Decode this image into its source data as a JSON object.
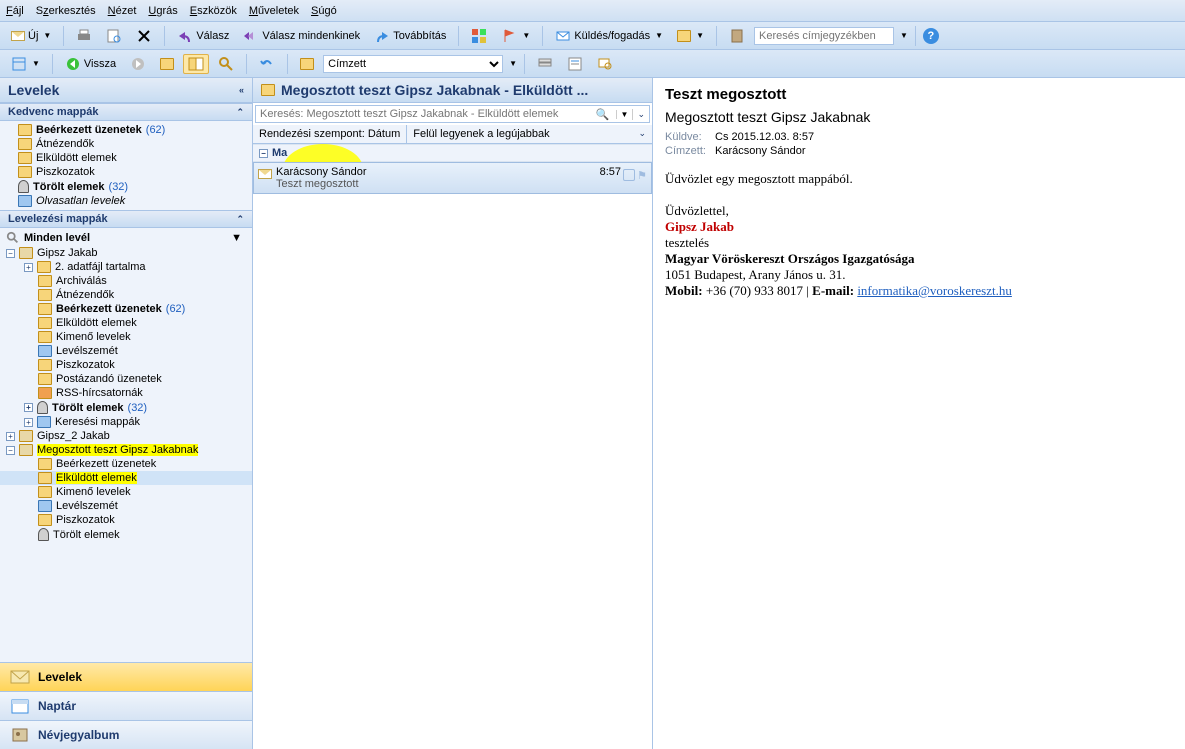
{
  "menu": {
    "file": "Fájl",
    "edit": "Szerkesztés",
    "view": "Nézet",
    "go": "Ugrás",
    "tools": "Eszközök",
    "actions": "Műveletek",
    "help": "Súgó"
  },
  "tb1": {
    "new": "Új",
    "reply": "Válasz",
    "replyall": "Válasz mindenkinek",
    "forward": "Továbbítás",
    "sendreceive": "Küldés/fogadás",
    "search_placeholder": "Keresés címjegyzékben"
  },
  "tb2": {
    "back": "Vissza",
    "field": "Címzett"
  },
  "left": {
    "header": "Levelek",
    "fav_header": "Kedvenc mappák",
    "fav": [
      {
        "label": "Beérkezett üzenetek",
        "count": "(62)",
        "bold": true,
        "ico": "yellow"
      },
      {
        "label": "Átnézendők",
        "ico": "yellow"
      },
      {
        "label": "Elküldött elemek",
        "ico": "yellow"
      },
      {
        "label": "Piszkozatok",
        "ico": "yellow"
      },
      {
        "label": "Törölt elemek",
        "count": "(32)",
        "bold": true,
        "ico": "trash"
      },
      {
        "label": "Olvasatlan levelek",
        "italic": true,
        "ico": "blue"
      }
    ],
    "mail_header": "Levelezési mappák",
    "all_label": "Minden levél",
    "tree_root": "Gipsz Jakab",
    "tree": [
      {
        "label": "2. adatfájl tartalma",
        "ind": 2,
        "ico": "yellow",
        "exp": "+"
      },
      {
        "label": "Archiválás",
        "ind": 2,
        "ico": "yellow"
      },
      {
        "label": "Átnézendők",
        "ind": 2,
        "ico": "yellow"
      },
      {
        "label": "Beérkezett üzenetek",
        "count": "(62)",
        "ind": 2,
        "bold": true,
        "ico": "yellow"
      },
      {
        "label": "Elküldött elemek",
        "ind": 2,
        "ico": "yellow"
      },
      {
        "label": "Kimenő levelek",
        "ind": 2,
        "ico": "yellow"
      },
      {
        "label": "Levélszemét",
        "ind": 2,
        "ico": "blue"
      },
      {
        "label": "Piszkozatok",
        "ind": 2,
        "ico": "yellow"
      },
      {
        "label": "Postázandó üzenetek",
        "ind": 2,
        "ico": "yellow"
      },
      {
        "label": "RSS-hírcsatornák",
        "ind": 2,
        "ico": "yellow"
      },
      {
        "label": "Törölt elemek",
        "count": "(32)",
        "ind": 2,
        "bold": true,
        "ico": "trash",
        "exp": "+"
      },
      {
        "label": "Keresési mappák",
        "ind": 2,
        "ico": "blue",
        "exp": "+"
      }
    ],
    "root2": "Gipsz_2 Jakab",
    "root3": "Megosztott teszt Gipsz Jakabnak",
    "sub3": [
      {
        "label": "Beérkezett üzenetek",
        "ico": "yellow"
      },
      {
        "label": "Elküldött elemek",
        "ico": "yellow",
        "hl": true
      },
      {
        "label": "Kimenő levelek",
        "ico": "yellow"
      },
      {
        "label": "Levélszemét",
        "ico": "blue"
      },
      {
        "label": "Piszkozatok",
        "ico": "yellow"
      },
      {
        "label": "Törölt elemek",
        "ico": "trash"
      }
    ],
    "nav": {
      "mail": "Levelek",
      "calendar": "Naptár",
      "contacts": "Névjegyalbum"
    }
  },
  "mid": {
    "title": "Megosztott teszt Gipsz Jakabnak - Elküldött ...",
    "search_placeholder": "Keresés: Megosztott teszt Gipsz Jakabnak - Elküldött elemek",
    "sort_by": "Rendezési szempont: Dátum",
    "sort_order": "Felül legyenek a legújabbak",
    "group": "Ma",
    "msg": {
      "from": "Karácsony Sándor",
      "subject": "Teszt megosztott",
      "time": "8:57"
    }
  },
  "right": {
    "subject": "Teszt megosztott",
    "to_line": "Megosztott teszt Gipsz Jakabnak",
    "sent_lbl": "Küldve:",
    "sent_val": "Cs 2015.12.03. 8:57",
    "rcpt_lbl": "Címzett:",
    "rcpt_val": "Karácsony Sándor",
    "greeting": "Üdvözlet egy megosztott mappából.",
    "closing": "Üdvözlettel,",
    "sig_name": "Gipsz Jakab",
    "sig_role": "tesztelés",
    "sig_org": "Magyar Vöröskereszt Országos Igazgatósága",
    "sig_addr": "1051 Budapest, Arany János u. 31.",
    "sig_mobile_lbl": "Mobil:",
    "sig_mobile": "+36 (70) 933 8017",
    "sig_email_lbl": "E-mail:",
    "sig_email": "informatika@voroskereszt.hu"
  }
}
